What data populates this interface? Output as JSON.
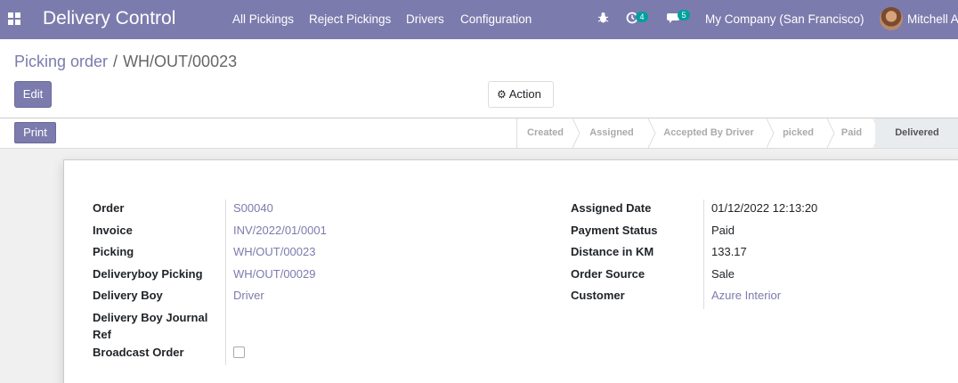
{
  "navbar": {
    "app_name": "Delivery Control",
    "menu": [
      "All Pickings",
      "Reject Pickings",
      "Drivers",
      "Configuration"
    ],
    "activity_badge": "4",
    "message_badge": "5",
    "company": "My Company (San Francisco)",
    "user": "Mitchell Admin"
  },
  "breadcrumb": {
    "parent": "Picking order",
    "current": "WH/OUT/00023"
  },
  "buttons": {
    "edit": "Edit",
    "action": "Action",
    "print": "Print"
  },
  "stages": [
    {
      "label": "Created",
      "active": false
    },
    {
      "label": "Assigned",
      "active": false
    },
    {
      "label": "Accepted By Driver",
      "active": false
    },
    {
      "label": "picked",
      "active": false
    },
    {
      "label": "Paid",
      "active": false
    },
    {
      "label": "Delivered",
      "active": true
    }
  ],
  "fields_left": [
    {
      "label": "Order",
      "value": "S00040",
      "link": true
    },
    {
      "label": "Invoice",
      "value": "INV/2022/01/0001",
      "link": true
    },
    {
      "label": "Picking",
      "value": "WH/OUT/00023",
      "link": true
    },
    {
      "label": "Deliveryboy Picking",
      "value": "WH/OUT/00029",
      "link": true
    },
    {
      "label": "Delivery Boy",
      "value": "Driver",
      "link": true
    },
    {
      "label": "Delivery Boy Journal Ref",
      "value": "",
      "link": false
    },
    {
      "label": "Broadcast Order",
      "value": "",
      "checkbox": true,
      "checked": false
    }
  ],
  "fields_right": [
    {
      "label": "Assigned Date",
      "value": "01/12/2022 12:13:20",
      "link": false
    },
    {
      "label": "Payment Status",
      "value": "Paid",
      "link": false
    },
    {
      "label": "Distance in KM",
      "value": "133.17",
      "link": false
    },
    {
      "label": "Order Source",
      "value": "Sale",
      "link": false
    },
    {
      "label": "Customer",
      "value": "Azure Interior",
      "link": true
    }
  ],
  "colors": {
    "brand": "#7c7bad",
    "badge": "#00a09d"
  }
}
